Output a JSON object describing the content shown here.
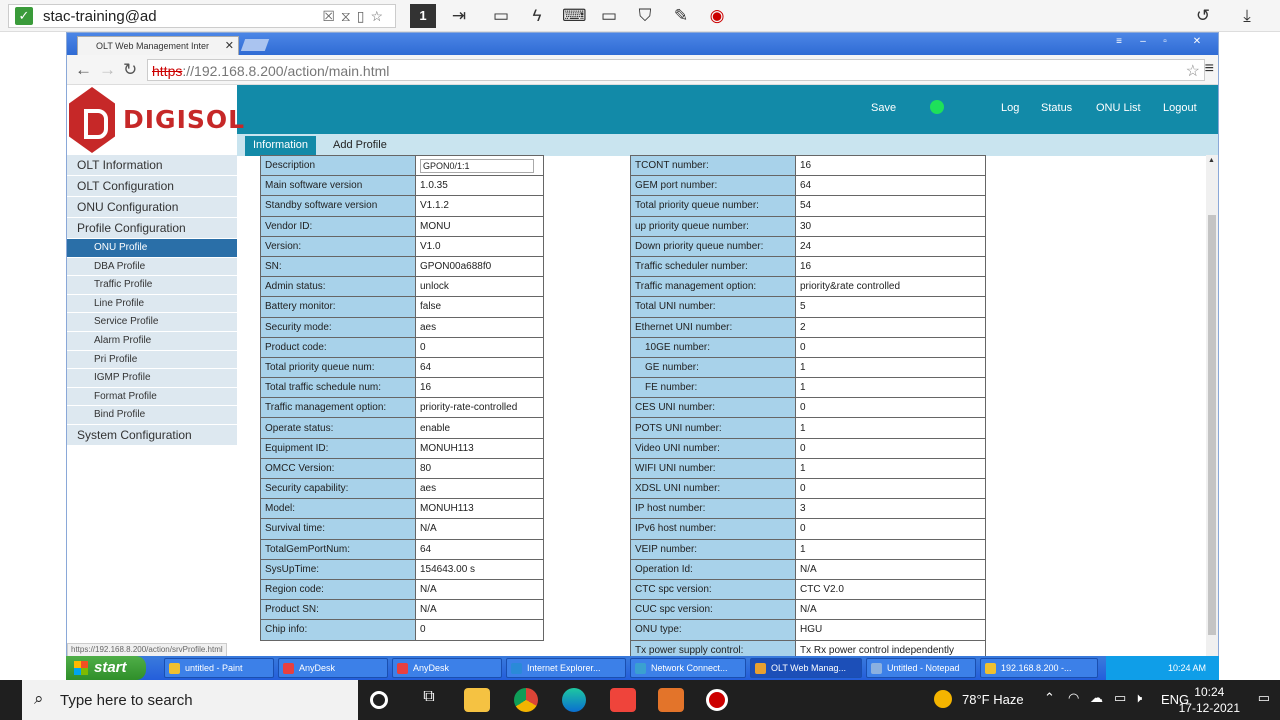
{
  "anydesk": {
    "address": "stac-training@ad",
    "tab_number": "1"
  },
  "browser": {
    "tab_title": "OLT Web Management Inter",
    "url_prefix": "https",
    "url_rest": "://192.168.8.200/action/main.html",
    "status_url": "https://192.168.8.200/action/srvProfile.html"
  },
  "header": {
    "brand": "DIGISOL",
    "save": "Save",
    "log": "Log",
    "status": "Status",
    "onu_list": "ONU List",
    "logout": "Logout"
  },
  "subtabs": {
    "information": "Information",
    "add_profile": "Add Profile"
  },
  "sidebar": {
    "olt_information": "OLT Information",
    "olt_configuration": "OLT Configuration",
    "onu_configuration": "ONU Configuration",
    "profile_configuration": "Profile Configuration",
    "sub": [
      "ONU Profile",
      "DBA Profile",
      "Traffic Profile",
      "Line Profile",
      "Service Profile",
      "Alarm Profile",
      "Pri Profile",
      "IGMP Profile",
      "Format Profile",
      "Bind Profile"
    ],
    "system_configuration": "System Configuration"
  },
  "left_table": [
    {
      "k": "Description",
      "v": "GPON0/1:1"
    },
    {
      "k": "Main software version",
      "v": "1.0.35"
    },
    {
      "k": "Standby software version",
      "v": "V1.1.2"
    },
    {
      "k": "Vendor ID:",
      "v": "MONU"
    },
    {
      "k": "Version:",
      "v": "V1.0"
    },
    {
      "k": "SN:",
      "v": "GPON00a688f0"
    },
    {
      "k": "Admin status:",
      "v": "unlock"
    },
    {
      "k": "Battery monitor:",
      "v": "false"
    },
    {
      "k": "Security mode:",
      "v": "aes"
    },
    {
      "k": "Product code:",
      "v": "0"
    },
    {
      "k": "Total priority queue num:",
      "v": "64"
    },
    {
      "k": "Total traffic schedule num:",
      "v": "16"
    },
    {
      "k": "Traffic management option:",
      "v": "priority-rate-controlled"
    },
    {
      "k": "Operate status:",
      "v": "enable"
    },
    {
      "k": "Equipment ID:",
      "v": "MONUH113"
    },
    {
      "k": "OMCC Version:",
      "v": "80"
    },
    {
      "k": "Security capability:",
      "v": "aes"
    },
    {
      "k": "Model:",
      "v": "MONUH113"
    },
    {
      "k": "Survival time:",
      "v": "N/A"
    },
    {
      "k": "TotalGemPortNum:",
      "v": "64"
    },
    {
      "k": "SysUpTime:",
      "v": "154643.00 s"
    },
    {
      "k": "Region code:",
      "v": "N/A"
    },
    {
      "k": "Product SN:",
      "v": "N/A"
    },
    {
      "k": "Chip info:",
      "v": "0"
    }
  ],
  "right_table": [
    {
      "k": "TCONT number:",
      "v": "16"
    },
    {
      "k": "GEM port number:",
      "v": "64"
    },
    {
      "k": "Total priority queue number:",
      "v": "54"
    },
    {
      "k": "up priority queue number:",
      "v": "30"
    },
    {
      "k": "Down priority queue number:",
      "v": "24"
    },
    {
      "k": "Traffic scheduler number:",
      "v": "16"
    },
    {
      "k": "Traffic management option:",
      "v": "priority&rate controlled"
    },
    {
      "k": "Total UNI number:",
      "v": "5"
    },
    {
      "k": "Ethernet UNI number:",
      "v": "2"
    },
    {
      "k": "10GE number:",
      "v": "0",
      "indent": true
    },
    {
      "k": "GE number:",
      "v": "1",
      "indent": true
    },
    {
      "k": "FE number:",
      "v": "1",
      "indent": true
    },
    {
      "k": "CES UNI number:",
      "v": "0"
    },
    {
      "k": "POTS UNI number:",
      "v": "1"
    },
    {
      "k": "Video UNI number:",
      "v": "0"
    },
    {
      "k": "WIFI UNI number:",
      "v": "1"
    },
    {
      "k": "XDSL UNI number:",
      "v": "0"
    },
    {
      "k": "IP host number:",
      "v": "3"
    },
    {
      "k": "IPv6 host number:",
      "v": "0"
    },
    {
      "k": "VEIP number:",
      "v": "1"
    },
    {
      "k": "Operation Id:",
      "v": "N/A"
    },
    {
      "k": "CTC spc version:",
      "v": "CTC V2.0"
    },
    {
      "k": "CUC spc version:",
      "v": "N/A"
    },
    {
      "k": "ONU type:",
      "v": "HGU"
    },
    {
      "k": "Tx power supply control:",
      "v": "Tx Rx power control independently"
    }
  ],
  "xp_taskbar": {
    "start": "start",
    "buttons": [
      "untitled - Paint",
      "AnyDesk",
      "AnyDesk",
      "Internet Explorer...",
      "Network Connect...",
      "OLT Web Manag...",
      "Untitled - Notepad",
      "192.168.8.200 -..."
    ],
    "clock": "10:24 AM"
  },
  "win_taskbar": {
    "search_placeholder": "Type here to search",
    "weather": "78°F  Haze",
    "lang": "ENG",
    "time": "10:24",
    "date": "17-12-2021"
  },
  "colors": {
    "header": "#128aa8",
    "brand_red": "#c62828",
    "status_green": "#1ee05a",
    "label_cell": "#a8d2ea"
  }
}
